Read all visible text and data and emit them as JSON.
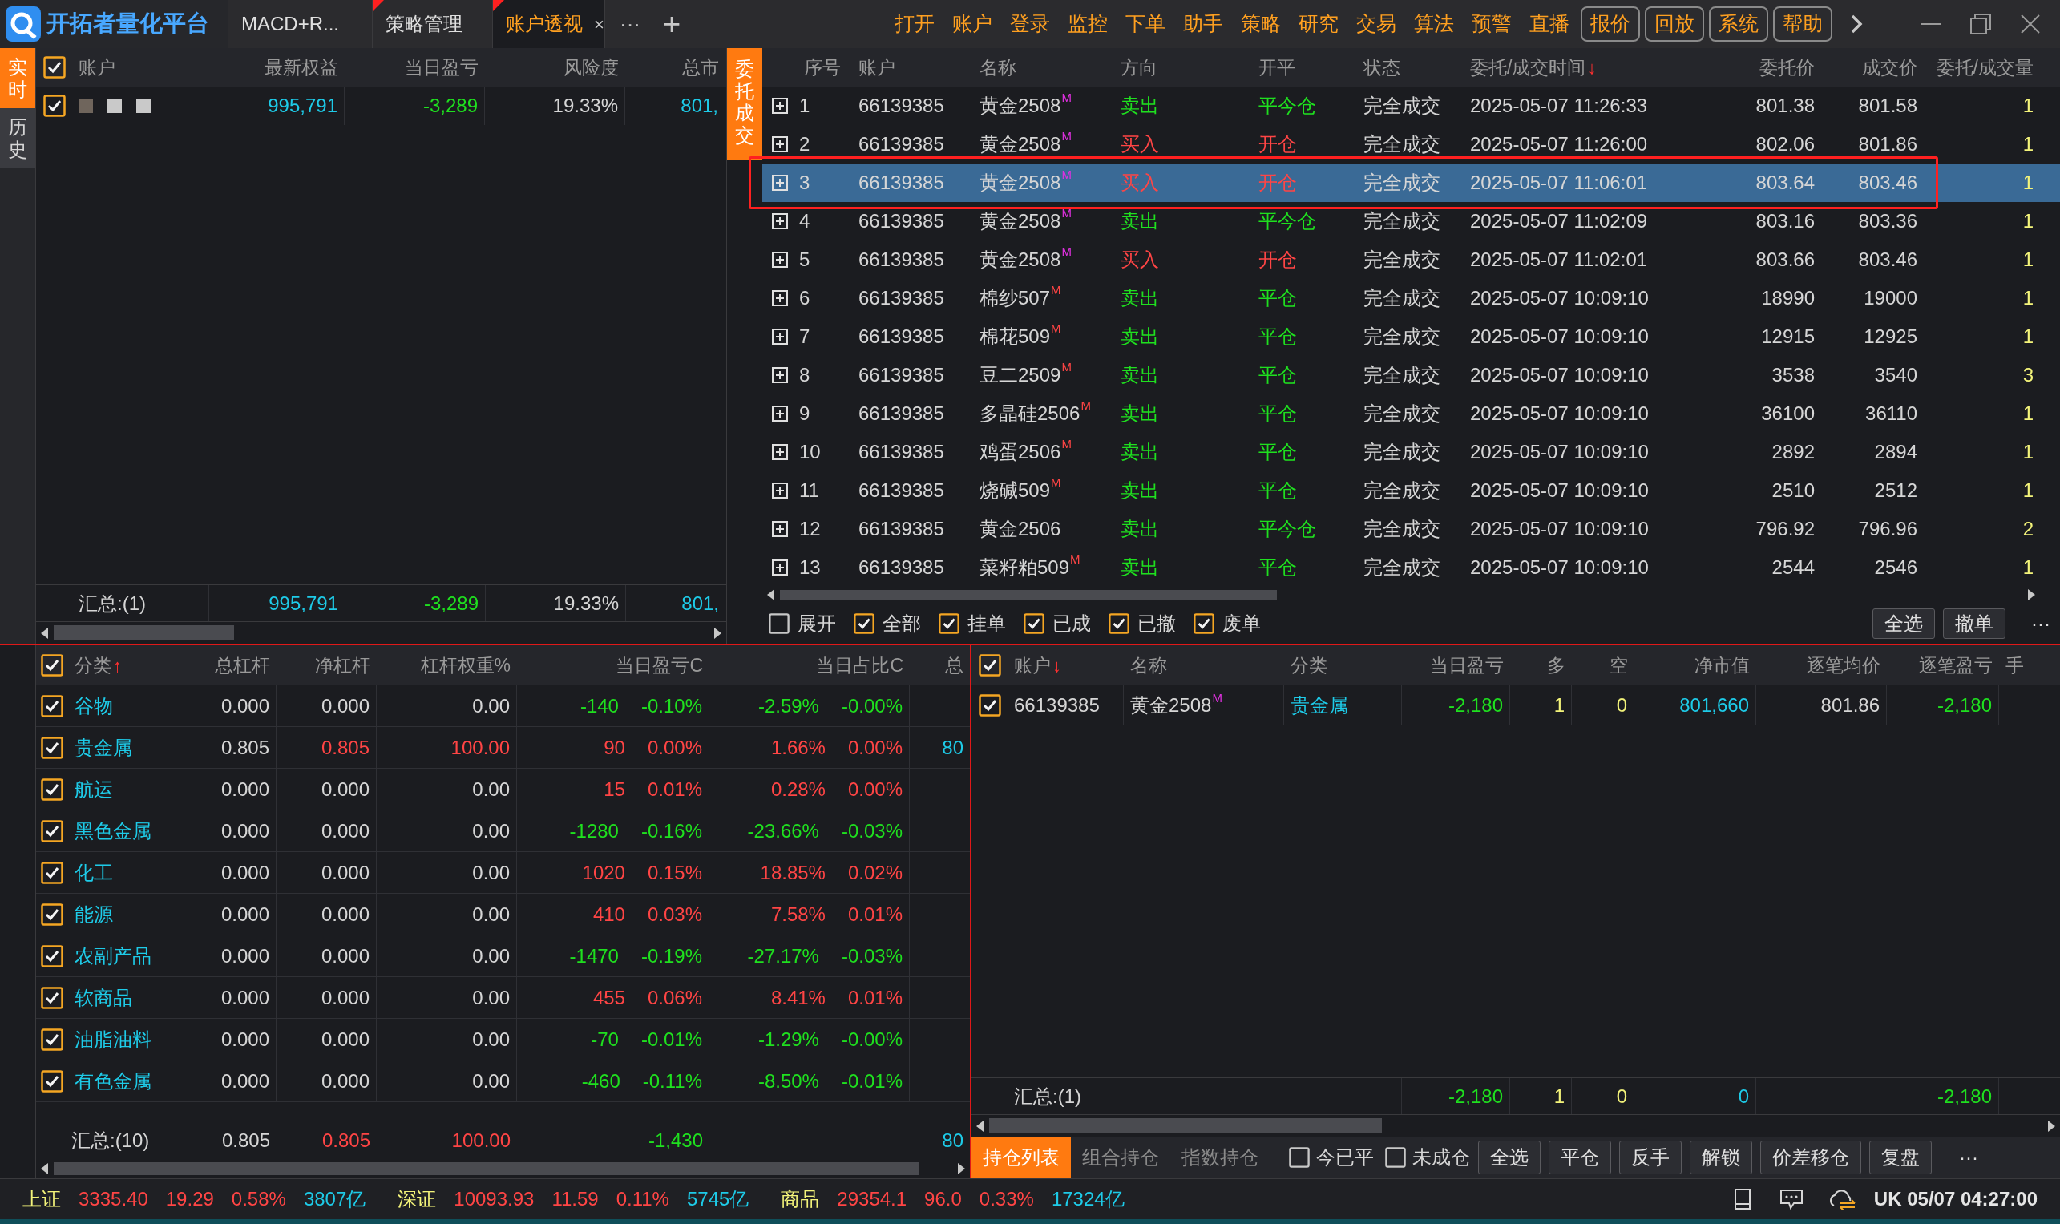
{
  "title_bar": {
    "logo": "开拓者量化平台",
    "more": "···",
    "add": "+",
    "tabs": [
      {
        "label": "MACD+R...",
        "selected": false,
        "flagged": false
      },
      {
        "label": "策略管理",
        "selected": false,
        "flagged": true
      },
      {
        "label": "账户透视",
        "selected": true,
        "flagged": true,
        "close": "×"
      }
    ],
    "menu": [
      {
        "label": "打开",
        "boxed": false
      },
      {
        "label": "账户",
        "boxed": false
      },
      {
        "label": "登录",
        "boxed": false
      },
      {
        "label": "监控",
        "boxed": false
      },
      {
        "label": "下单",
        "boxed": false
      },
      {
        "label": "助手",
        "boxed": false
      },
      {
        "label": "策略",
        "boxed": false
      },
      {
        "label": "研究",
        "boxed": false
      },
      {
        "label": "交易",
        "boxed": false
      },
      {
        "label": "算法",
        "boxed": false
      },
      {
        "label": "预警",
        "boxed": false
      },
      {
        "label": "直播",
        "boxed": false
      },
      {
        "label": "报价",
        "boxed": true
      },
      {
        "label": "回放",
        "boxed": true
      },
      {
        "label": "系统",
        "boxed": true
      },
      {
        "label": "帮助",
        "boxed": true
      }
    ]
  },
  "side_tabs": [
    {
      "label": "实时",
      "selected": true
    },
    {
      "label": "历史",
      "selected": false
    }
  ],
  "accounts": {
    "header_checked": true,
    "account_header": "账户",
    "columns": [
      {
        "label": "最新权益"
      },
      {
        "label": "当日盈亏"
      },
      {
        "label": "风险度"
      },
      {
        "label": "总市"
      }
    ],
    "rows": [
      {
        "checked": true,
        "redacted": true,
        "cells": [
          {
            "text": "995,791",
            "color": "#1ecbe8"
          },
          {
            "text": "-3,289",
            "color": "#1fe01f"
          },
          {
            "text": "19.33%",
            "color": "#d6d6d6"
          },
          {
            "text": "801,",
            "color": "#1ecbe8"
          }
        ]
      }
    ],
    "total": {
      "label": "汇总:(1)",
      "cells": [
        {
          "text": "995,791",
          "color": "#1ecbe8"
        },
        {
          "text": "-3,289",
          "color": "#1fe01f"
        },
        {
          "text": "19.33%",
          "color": "#d6d6d6"
        },
        {
          "text": "801,",
          "color": "#1ecbe8"
        }
      ]
    }
  },
  "orders": {
    "tab": {
      "label": "委托成交",
      "selected": true
    },
    "columns": [
      {
        "label": "序号"
      },
      {
        "label": "账户"
      },
      {
        "label": "名称"
      },
      {
        "label": "方向"
      },
      {
        "label": "开平"
      },
      {
        "label": "状态"
      },
      {
        "label": "委托/成交时间",
        "sort": "↓"
      },
      {
        "label": "委托价"
      },
      {
        "label": "成交价"
      },
      {
        "label": "委托/成交量"
      }
    ],
    "rows": [
      {
        "no": "1",
        "account": "66139385",
        "name": "黄金2508",
        "mark": {
          "text": "M",
          "color": "#e030e0"
        },
        "kind": "sell",
        "direction": "卖出",
        "offset": "平今仓",
        "status": "完全成交",
        "time": "2025-05-07 11:26:33",
        "order_price": "801.38",
        "fill_price": "801.58",
        "qty": "1",
        "selected": false,
        "outlined": false
      },
      {
        "no": "2",
        "account": "66139385",
        "name": "黄金2508",
        "mark": {
          "text": "M",
          "color": "#e030e0"
        },
        "kind": "buy",
        "direction": "买入",
        "offset": "开仓",
        "status": "完全成交",
        "time": "2025-05-07 11:26:00",
        "order_price": "802.06",
        "fill_price": "801.86",
        "qty": "1",
        "selected": false,
        "outlined": false
      },
      {
        "no": "3",
        "account": "66139385",
        "name": "黄金2508",
        "mark": {
          "text": "M",
          "color": "#e030e0"
        },
        "kind": "buy",
        "direction": "买入",
        "offset": "开仓",
        "status": "完全成交",
        "time": "2025-05-07 11:06:01",
        "order_price": "803.64",
        "fill_price": "803.46",
        "qty": "1",
        "selected": true,
        "outlined": true
      },
      {
        "no": "4",
        "account": "66139385",
        "name": "黄金2508",
        "mark": {
          "text": "M",
          "color": "#e030e0"
        },
        "kind": "sell",
        "direction": "卖出",
        "offset": "平今仓",
        "status": "完全成交",
        "time": "2025-05-07 11:02:09",
        "order_price": "803.16",
        "fill_price": "803.36",
        "qty": "1",
        "selected": false,
        "outlined": false
      },
      {
        "no": "5",
        "account": "66139385",
        "name": "黄金2508",
        "mark": {
          "text": "M",
          "color": "#e030e0"
        },
        "kind": "buy",
        "direction": "买入",
        "offset": "开仓",
        "status": "完全成交",
        "time": "2025-05-07 11:02:01",
        "order_price": "803.66",
        "fill_price": "803.46",
        "qty": "1",
        "selected": false,
        "outlined": false
      },
      {
        "no": "6",
        "account": "66139385",
        "name": "棉纱507",
        "mark": {
          "text": "M",
          "color": "#ff4545"
        },
        "kind": "sell",
        "direction": "卖出",
        "offset": "平仓",
        "status": "完全成交",
        "time": "2025-05-07 10:09:10",
        "order_price": "18990",
        "fill_price": "19000",
        "qty": "1",
        "selected": false,
        "outlined": false
      },
      {
        "no": "7",
        "account": "66139385",
        "name": "棉花509",
        "mark": {
          "text": "M",
          "color": "#ff4545"
        },
        "kind": "sell",
        "direction": "卖出",
        "offset": "平仓",
        "status": "完全成交",
        "time": "2025-05-07 10:09:10",
        "order_price": "12915",
        "fill_price": "12925",
        "qty": "1",
        "selected": false,
        "outlined": false
      },
      {
        "no": "8",
        "account": "66139385",
        "name": "豆二2509",
        "mark": {
          "text": "M",
          "color": "#ff4545"
        },
        "kind": "sell",
        "direction": "卖出",
        "offset": "平仓",
        "status": "完全成交",
        "time": "2025-05-07 10:09:10",
        "order_price": "3538",
        "fill_price": "3540",
        "qty": "3",
        "selected": false,
        "outlined": false
      },
      {
        "no": "9",
        "account": "66139385",
        "name": "多晶硅2506",
        "mark": {
          "text": "M",
          "color": "#ff4545"
        },
        "kind": "sell",
        "direction": "卖出",
        "offset": "平仓",
        "status": "完全成交",
        "time": "2025-05-07 10:09:10",
        "order_price": "36100",
        "fill_price": "36110",
        "qty": "1",
        "selected": false,
        "outlined": false
      },
      {
        "no": "10",
        "account": "66139385",
        "name": "鸡蛋2506",
        "mark": {
          "text": "M",
          "color": "#ff4545"
        },
        "kind": "sell",
        "direction": "卖出",
        "offset": "平仓",
        "status": "完全成交",
        "time": "2025-05-07 10:09:10",
        "order_price": "2892",
        "fill_price": "2894",
        "qty": "1",
        "selected": false,
        "outlined": false
      },
      {
        "no": "11",
        "account": "66139385",
        "name": "烧碱509",
        "mark": {
          "text": "M",
          "color": "#ff4545"
        },
        "kind": "sell",
        "direction": "卖出",
        "offset": "平仓",
        "status": "完全成交",
        "time": "2025-05-07 10:09:10",
        "order_price": "2510",
        "fill_price": "2512",
        "qty": "1",
        "selected": false,
        "outlined": false
      },
      {
        "no": "12",
        "account": "66139385",
        "name": "黄金2506",
        "kind": "sell",
        "direction": "卖出",
        "offset": "平今仓",
        "status": "完全成交",
        "time": "2025-05-07 10:09:10",
        "order_price": "796.92",
        "fill_price": "796.96",
        "qty": "2",
        "selected": false,
        "outlined": false
      },
      {
        "no": "13",
        "account": "66139385",
        "name": "菜籽粕509",
        "mark": {
          "text": "M",
          "color": "#ff4545"
        },
        "kind": "sell",
        "direction": "卖出",
        "offset": "平仓",
        "status": "完全成交",
        "time": "2025-05-07 10:09:10",
        "order_price": "2544",
        "fill_price": "2546",
        "qty": "1",
        "selected": false,
        "outlined": false
      }
    ],
    "filters": [
      {
        "label": "展开",
        "checked": false
      },
      {
        "label": "全部",
        "checked": true
      },
      {
        "label": "挂单",
        "checked": true
      },
      {
        "label": "已成",
        "checked": true
      },
      {
        "label": "已撤",
        "checked": true
      },
      {
        "label": "废单",
        "checked": true
      }
    ],
    "buttons": [
      "全选",
      "撤单"
    ],
    "more": "···"
  },
  "categories": {
    "header_checked": true,
    "columns": [
      {
        "label": "分类",
        "sort": "↑"
      },
      {
        "label": "总杠杆"
      },
      {
        "label": "净杠杆"
      },
      {
        "label": "杠杆权重%"
      },
      {
        "label": "当日盈亏C"
      },
      {
        "label": "当日占比C"
      },
      {
        "label": "总"
      }
    ],
    "rows": [
      {
        "checked": true,
        "cells": [
          {
            "text": "谷物",
            "color": "#1ecbe8"
          },
          {
            "text": "0.000",
            "color": "#d6d6d6"
          },
          {
            "text": "0.000",
            "color": "#d6d6d6"
          },
          {
            "text": "0.00",
            "color": "#d6d6d6"
          },
          {
            "text": "-140",
            "percent": "-0.10%",
            "color": "#1fe01f"
          },
          {
            "text": "-2.59%",
            "percent": "-0.00%",
            "color": "#1fe01f"
          }
        ]
      },
      {
        "checked": true,
        "cells": [
          {
            "text": "贵金属",
            "color": "#1ecbe8"
          },
          {
            "text": "0.805",
            "color": "#d6d6d6"
          },
          {
            "text": "0.805",
            "color": "#ff4545"
          },
          {
            "text": "100.00",
            "color": "#ff4545"
          },
          {
            "text": "90",
            "percent": "0.00%",
            "color": "#ff4545"
          },
          {
            "text": "1.66%",
            "percent": "0.00%",
            "color": "#ff4545"
          },
          {
            "text": "80",
            "color": "#1ecbe8"
          }
        ]
      },
      {
        "checked": true,
        "cells": [
          {
            "text": "航运",
            "color": "#1ecbe8"
          },
          {
            "text": "0.000",
            "color": "#d6d6d6"
          },
          {
            "text": "0.000",
            "color": "#d6d6d6"
          },
          {
            "text": "0.00",
            "color": "#d6d6d6"
          },
          {
            "text": "15",
            "percent": "0.01%",
            "color": "#ff4545"
          },
          {
            "text": "0.28%",
            "percent": "0.00%",
            "color": "#ff4545"
          }
        ]
      },
      {
        "checked": true,
        "cells": [
          {
            "text": "黑色金属",
            "color": "#1ecbe8"
          },
          {
            "text": "0.000",
            "color": "#d6d6d6"
          },
          {
            "text": "0.000",
            "color": "#d6d6d6"
          },
          {
            "text": "0.00",
            "color": "#d6d6d6"
          },
          {
            "text": "-1280",
            "percent": "-0.16%",
            "color": "#1fe01f"
          },
          {
            "text": "-23.66%",
            "percent": "-0.03%",
            "color": "#1fe01f"
          }
        ]
      },
      {
        "checked": true,
        "cells": [
          {
            "text": "化工",
            "color": "#1ecbe8"
          },
          {
            "text": "0.000",
            "color": "#d6d6d6"
          },
          {
            "text": "0.000",
            "color": "#d6d6d6"
          },
          {
            "text": "0.00",
            "color": "#d6d6d6"
          },
          {
            "text": "1020",
            "percent": "0.15%",
            "color": "#ff4545"
          },
          {
            "text": "18.85%",
            "percent": "0.02%",
            "color": "#ff4545"
          }
        ]
      },
      {
        "checked": true,
        "cells": [
          {
            "text": "能源",
            "color": "#1ecbe8"
          },
          {
            "text": "0.000",
            "color": "#d6d6d6"
          },
          {
            "text": "0.000",
            "color": "#d6d6d6"
          },
          {
            "text": "0.00",
            "color": "#d6d6d6"
          },
          {
            "text": "410",
            "percent": "0.03%",
            "color": "#ff4545"
          },
          {
            "text": "7.58%",
            "percent": "0.01%",
            "color": "#ff4545"
          }
        ]
      },
      {
        "checked": true,
        "cells": [
          {
            "text": "农副产品",
            "color": "#1ecbe8"
          },
          {
            "text": "0.000",
            "color": "#d6d6d6"
          },
          {
            "text": "0.000",
            "color": "#d6d6d6"
          },
          {
            "text": "0.00",
            "color": "#d6d6d6"
          },
          {
            "text": "-1470",
            "percent": "-0.19%",
            "color": "#1fe01f"
          },
          {
            "text": "-27.17%",
            "percent": "-0.03%",
            "color": "#1fe01f"
          }
        ]
      },
      {
        "checked": true,
        "cells": [
          {
            "text": "软商品",
            "color": "#1ecbe8"
          },
          {
            "text": "0.000",
            "color": "#d6d6d6"
          },
          {
            "text": "0.000",
            "color": "#d6d6d6"
          },
          {
            "text": "0.00",
            "color": "#d6d6d6"
          },
          {
            "text": "455",
            "percent": "0.06%",
            "color": "#ff4545"
          },
          {
            "text": "8.41%",
            "percent": "0.01%",
            "color": "#ff4545"
          }
        ]
      },
      {
        "checked": true,
        "cells": [
          {
            "text": "油脂油料",
            "color": "#1ecbe8"
          },
          {
            "text": "0.000",
            "color": "#d6d6d6"
          },
          {
            "text": "0.000",
            "color": "#d6d6d6"
          },
          {
            "text": "0.00",
            "color": "#d6d6d6"
          },
          {
            "text": "-70",
            "percent": "-0.01%",
            "color": "#1fe01f"
          },
          {
            "text": "-1.29%",
            "percent": "-0.00%",
            "color": "#1fe01f"
          }
        ]
      },
      {
        "checked": true,
        "cells": [
          {
            "text": "有色金属",
            "color": "#1ecbe8"
          },
          {
            "text": "0.000",
            "color": "#d6d6d6"
          },
          {
            "text": "0.000",
            "color": "#d6d6d6"
          },
          {
            "text": "0.00",
            "color": "#d6d6d6"
          },
          {
            "text": "-460",
            "percent": "-0.11%",
            "color": "#1fe01f"
          },
          {
            "text": "-8.50%",
            "percent": "-0.01%",
            "color": "#1fe01f"
          }
        ]
      }
    ],
    "total": {
      "label": "汇总:(10)",
      "cells": [
        {
          "text": "0.805",
          "color": "#d6d6d6"
        },
        {
          "text": "0.805",
          "color": "#ff4545"
        },
        {
          "text": "100.00",
          "color": "#ff4545"
        },
        {
          "text": "-1,430",
          "color": "#1fe01f"
        },
        {
          "text": "80",
          "color": "#1ecbe8"
        }
      ]
    }
  },
  "positions": {
    "header_checked": true,
    "columns": [
      {
        "label": "账户",
        "sort": "↓"
      },
      {
        "label": "名称"
      },
      {
        "label": "分类"
      },
      {
        "label": "当日盈亏"
      },
      {
        "label": "多"
      },
      {
        "label": "空"
      },
      {
        "label": "净市值"
      },
      {
        "label": "逐笔均价"
      },
      {
        "label": "逐笔盈亏"
      },
      {
        "label": "手"
      }
    ],
    "rows": [
      {
        "checked": true,
        "cells": [
          {
            "text": "66139385",
            "color": "#d6d6d6"
          },
          {
            "text": "黄金2508",
            "mark": {
              "text": "M",
              "color": "#e030e0"
            },
            "color": "#d6d6d6"
          },
          {
            "text": "贵金属",
            "color": "#1ecbe8"
          },
          {
            "text": "-2,180",
            "color": "#1fe01f"
          },
          {
            "text": "1",
            "color": "#f3f37a"
          },
          {
            "text": "0",
            "color": "#f3f37a"
          },
          {
            "text": "801,660",
            "color": "#1ecbe8"
          },
          {
            "text": "801.86",
            "color": "#d6d6d6"
          },
          {
            "text": "-2,180",
            "color": "#1fe01f"
          }
        ]
      }
    ],
    "total": {
      "label": "汇总:(1)",
      "cells": [
        {
          "text": "-2,180",
          "color": "#1fe01f"
        },
        {
          "text": "1",
          "color": "#f3f37a"
        },
        {
          "text": "0",
          "color": "#f3f37a"
        },
        {
          "text": "0",
          "color": "#1ecbe8"
        },
        {
          "text": "-2,180",
          "color": "#1fe01f"
        }
      ]
    },
    "tabs": [
      {
        "label": "持仓列表",
        "selected": true
      },
      {
        "label": "组合持仓",
        "selected": false
      },
      {
        "label": "指数持仓",
        "selected": false
      }
    ],
    "options": [
      {
        "label": "今已平",
        "checked": false
      },
      {
        "label": "未成仓",
        "checked": false
      }
    ],
    "buttons": [
      "全选",
      "平仓",
      "反手",
      "解锁",
      "价差移仓",
      "复盘"
    ],
    "more": "···"
  },
  "status_bar": {
    "markets": [
      {
        "name": "上证",
        "price": "3335.40",
        "change": "19.29",
        "pct": "0.58%",
        "volume": "3807亿",
        "color": "#ff4545"
      },
      {
        "name": "深证",
        "price": "10093.93",
        "change": "11.59",
        "pct": "0.11%",
        "volume": "5745亿",
        "color": "#ff4545"
      },
      {
        "name": "商品",
        "price": "29354.1",
        "change": "96.0",
        "pct": "0.33%",
        "volume": "17324亿",
        "color": "#ff4545"
      }
    ],
    "clock": "UK 05/07 04:27:00"
  }
}
